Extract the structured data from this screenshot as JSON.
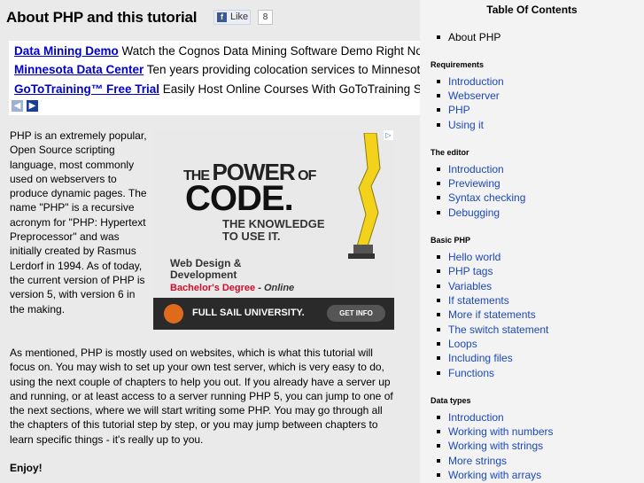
{
  "page": {
    "title": "About PHP and this tutorial",
    "like_label": "Like",
    "like_count": "8"
  },
  "ads": {
    "rows": [
      {
        "link": "Data Mining Demo",
        "desc": "Watch the Cognos Data Mining Software Demo Right Now."
      },
      {
        "link": "Minnesota Data Center",
        "desc": "Ten years providing colocation services to Minnesota b"
      },
      {
        "link": "GoToTraining™ Free Trial",
        "desc": "Easily Host Online Courses With GoToTraining Sof"
      }
    ],
    "prev_arrow": "◀",
    "next_arrow": "▶"
  },
  "banner": {
    "line1a": "THE ",
    "line1b": "POWER",
    "line1c": " OF",
    "line2": "CODE.",
    "line3a": "THE KNOWLEDGE",
    "line3b": "TO USE IT.",
    "line4a": "Web Design &",
    "line4b": "Development",
    "degree": "Bachelor's Degree",
    "mode": " - Online",
    "university": "FULL SAIL UNIVERSITY.",
    "cta": "GET INFO",
    "adchoice": "▷"
  },
  "content": {
    "p1": "PHP is an extremely popular, Open Source scripting language, most commonly used on webservers to produce dynamic pages. The name \"PHP\" is a recursive acronym for \"PHP: Hypertext Preprocessor\" and was initially created by Rasmus Lerdorf in 1994. As of today, the current version of PHP is version 5, with version 6 in the making.",
    "p2": "As mentioned, PHP is mostly used on websites, which is what this tutorial will focus on. You may wish to set up your own test server, which is very easy to do, using the next couple of chapters to help you out. If you already have a server up and running, or at least access to a server running PHP 5, you can jump to one of the next sections, where we will start writing some PHP. You may go through all the chapters of this tutorial step by step, or you may jump between chapters to learn specific things - it's really up to you.",
    "enjoy": "Enjoy!"
  },
  "toc": {
    "title": "Table Of Contents",
    "first": "About PHP",
    "sections": [
      {
        "name": "Requirements",
        "items": [
          "Introduction",
          "Webserver",
          "PHP",
          "Using it"
        ]
      },
      {
        "name": "The editor",
        "items": [
          "Introduction",
          "Previewing",
          "Syntax checking",
          "Debugging"
        ]
      },
      {
        "name": "Basic PHP",
        "items": [
          "Hello world",
          "PHP tags",
          "Variables",
          "If statements",
          "More if statements",
          "The switch statement",
          "Loops",
          "Including files",
          "Functions"
        ]
      },
      {
        "name": "Data types",
        "items": [
          "Introduction",
          "Working with numbers",
          "Working with strings",
          "More strings",
          "Working with arrays"
        ]
      }
    ]
  },
  "colors": {
    "link": "#1c48b8",
    "ad_link": "#0000cc",
    "fb_blue": "#3b5998",
    "sidebar_bg": "#f3f3f3",
    "main_bg": "#eaeaea"
  }
}
